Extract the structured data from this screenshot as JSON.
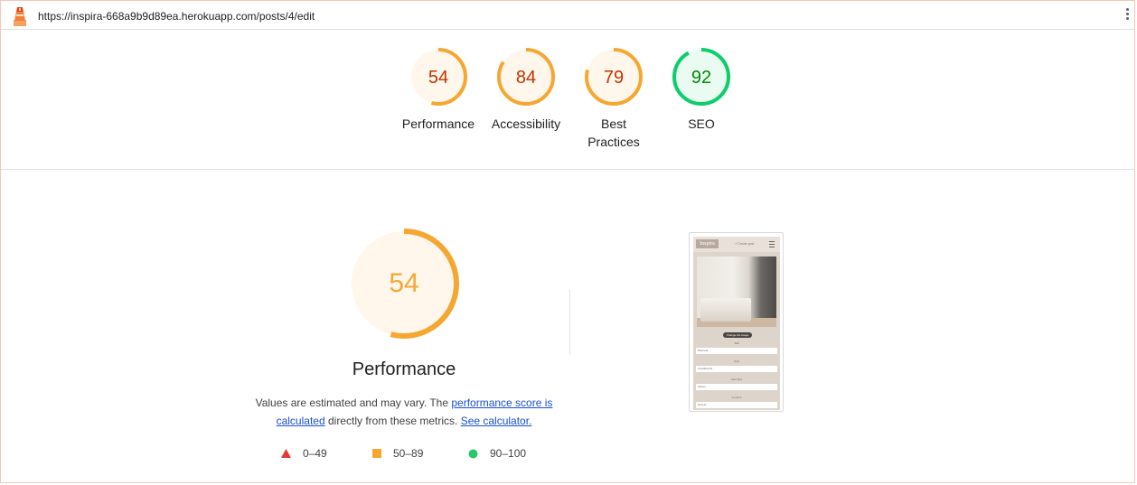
{
  "topbar": {
    "url": "https://inspira-668a9b9d89ea.herokuapp.com/posts/4/edit"
  },
  "gauges": [
    {
      "key": "performance",
      "score": 54,
      "label": "Performance",
      "color": "#f5a732",
      "text_color": "#c33300",
      "fill": "#fff7ec"
    },
    {
      "key": "accessibility",
      "score": 84,
      "label": "Accessibility",
      "color": "#f5a732",
      "text_color": "#c33300",
      "fill": "#fff7ec"
    },
    {
      "key": "best_practices",
      "score": 79,
      "label": "Best Practices",
      "color": "#f5a732",
      "text_color": "#c33300",
      "fill": "#fff7ec"
    },
    {
      "key": "seo",
      "score": 92,
      "label": "SEO",
      "color": "#0cce6b",
      "text_color": "#008800",
      "fill": "#eafbf1"
    }
  ],
  "main": {
    "score": 54,
    "score_color": "#f5a732",
    "title": "Performance",
    "desc_prefix": "Values are estimated and may vary. The ",
    "desc_link1": "performance score is calculated",
    "desc_middle": " directly from these metrics. ",
    "desc_link2": "See calculator."
  },
  "legend": [
    {
      "shape": "triangle",
      "range": "0–49",
      "color": "#e53935"
    },
    {
      "shape": "square",
      "range": "50–89",
      "color": "#f5a732"
    },
    {
      "shape": "circle",
      "range": "90–100",
      "color": "#28c76f"
    }
  ],
  "screenshot": {
    "brand": "Inspira",
    "create_link": "+ Create post",
    "change_image_button": "Change the image",
    "fields": [
      {
        "label": "Title",
        "value": "Bedroom"
      },
      {
        "label": "Style",
        "value": "Scandinavian"
      },
      {
        "label": "Area Type",
        "value": "Interior"
      },
      {
        "label": "Location",
        "value": "Norway"
      }
    ]
  }
}
